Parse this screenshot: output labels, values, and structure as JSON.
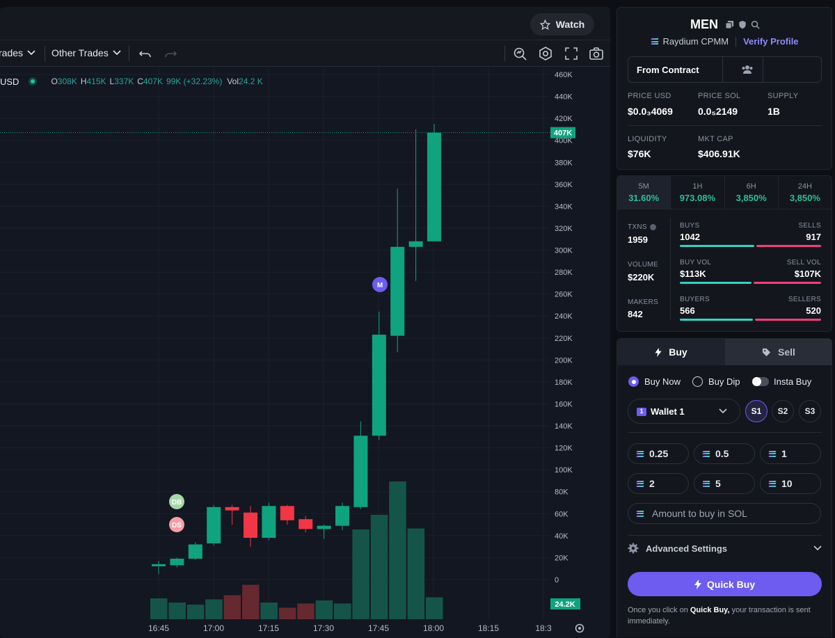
{
  "chart": {
    "topbar": {
      "watch_label": "Watch"
    },
    "toolbar": {
      "trades_label": "rades",
      "other_trades_label": "Other Trades"
    },
    "legend": {
      "symbol": "USD",
      "o_label": "O",
      "o_value": "308K",
      "h_label": "H",
      "h_value": "415K",
      "l_label": "L",
      "l_value": "337K",
      "c_label": "C",
      "c_value": "407K",
      "change": "99K (+32.23%)",
      "vol_label": "Vol",
      "vol_value": "24.2 K"
    },
    "price_tag": "407K",
    "volume_tag": "24.2K",
    "markers": {
      "db": "DB",
      "ds": "DS",
      "m": "M"
    }
  },
  "chart_data": {
    "type": "candlestick",
    "x_tick_labels": [
      "16:45",
      "17:00",
      "17:15",
      "17:30",
      "17:45",
      "18:00",
      "18:15",
      "18:3"
    ],
    "y_tick_labels": [
      "460K",
      "440K",
      "420K",
      "400K",
      "380K",
      "360K",
      "340K",
      "320K",
      "300K",
      "280K",
      "260K",
      "240K",
      "220K",
      "200K",
      "180K",
      "160K",
      "140K",
      "120K",
      "100K",
      "80K",
      "60K",
      "40K",
      "20K",
      "0"
    ],
    "ylim": [
      0,
      460000
    ],
    "candles": [
      {
        "o": 14000,
        "h": 17000,
        "l": 5000,
        "c": 14000,
        "dir": "up",
        "o2": 5000
      },
      {
        "o": 13000,
        "h": 20000,
        "l": 11000,
        "c": 19000
      },
      {
        "o": 19000,
        "h": 34000,
        "l": 18000,
        "c": 32000
      },
      {
        "o": 33000,
        "h": 68000,
        "l": 31000,
        "c": 66000
      },
      {
        "o": 66000,
        "h": 68000,
        "l": 50000,
        "c": 63000
      },
      {
        "o": 61000,
        "h": 67000,
        "l": 30000,
        "c": 38000
      },
      {
        "o": 38000,
        "h": 70000,
        "l": 36000,
        "c": 67000
      },
      {
        "o": 67000,
        "h": 68000,
        "l": 50000,
        "c": 54000
      },
      {
        "o": 55000,
        "h": 58000,
        "l": 43000,
        "c": 46000
      },
      {
        "o": 46000,
        "h": 50000,
        "l": 37000,
        "c": 49000
      },
      {
        "o": 49000,
        "h": 70000,
        "l": 45000,
        "c": 67000
      },
      {
        "o": 66000,
        "h": 144000,
        "l": 64000,
        "c": 131000
      },
      {
        "o": 131000,
        "h": 244000,
        "l": 127000,
        "c": 223000
      },
      {
        "o": 222000,
        "h": 356000,
        "l": 207000,
        "c": 303000
      },
      {
        "o": 303000,
        "h": 410000,
        "l": 272000,
        "c": 308000
      },
      {
        "o": 308000,
        "h": 415000,
        "l": 337000,
        "c": 407000
      }
    ],
    "volume": [
      0.2,
      0.16,
      0.14,
      0.19,
      0.23,
      0.33,
      0.16,
      0.11,
      0.15,
      0.18,
      0.15,
      0.86,
      1.0,
      1.32,
      0.87,
      0.21
    ],
    "current_price": 407000,
    "volume_current": "24.2K"
  },
  "token": {
    "name": "MEN",
    "dex": "Raydium CPMM",
    "verify_label": "Verify Profile",
    "from_contract": "From Contract",
    "price_usd_label": "PRICE USD",
    "price_usd": "$0.0₃4069",
    "price_sol_label": "PRICE SOL",
    "price_sol": "0.0₅2149",
    "supply_label": "SUPPLY",
    "supply": "1B",
    "liquidity_label": "LIQUIDITY",
    "liquidity": "$76K",
    "mktcap_label": "MKT CAP",
    "mktcap": "$406.91K"
  },
  "changes": [
    {
      "label": "5M",
      "value": "31.60%"
    },
    {
      "label": "1H",
      "value": "973.08%"
    },
    {
      "label": "6H",
      "value": "3,850%"
    },
    {
      "label": "24H",
      "value": "3,850%"
    }
  ],
  "stats": {
    "txns_label": "TXNS",
    "txns": "1959",
    "volume_label": "VOLUME",
    "volume": "$220K",
    "makers_label": "MAKERS",
    "makers": "842",
    "buys_label": "BUYS",
    "buys": "1042",
    "sells_label": "SELLS",
    "sells": "917",
    "buyvol_label": "BUY VOL",
    "buyvol": "$113K",
    "sellvol_label": "SELL VOL",
    "sellvol": "$107K",
    "buyers_label": "BUYERS",
    "buyers": "566",
    "sellers_label": "SELLERS",
    "sellers": "520",
    "buys_ratio": 0.532,
    "buyvol_ratio": 0.514,
    "buyers_ratio": 0.521
  },
  "trade": {
    "tab_buy": "Buy",
    "tab_sell": "Sell",
    "mode_buy_now": "Buy Now",
    "mode_buy_dip": "Buy Dip",
    "mode_insta": "Insta Buy",
    "wallet": "Wallet 1",
    "wallet_count": "1",
    "slots": [
      "S1",
      "S2",
      "S3"
    ],
    "amounts": [
      "0.25",
      "0.5",
      "1",
      "2",
      "5",
      "10"
    ],
    "amount_placeholder": "Amount to buy in SOL",
    "advanced_label": "Advanced Settings",
    "quick_buy": "Quick Buy",
    "note_prefix": "Once you click on ",
    "note_bold": "Quick Buy,",
    "note_suffix": " your transaction is sent immediately."
  },
  "colors": {
    "up": "#10a37f",
    "down": "#f23645",
    "accent": "#6e5cf0",
    "green_text": "#2ebd9c",
    "pink_bar": "#f43f7a",
    "teal_bar": "#2fd4c4"
  }
}
